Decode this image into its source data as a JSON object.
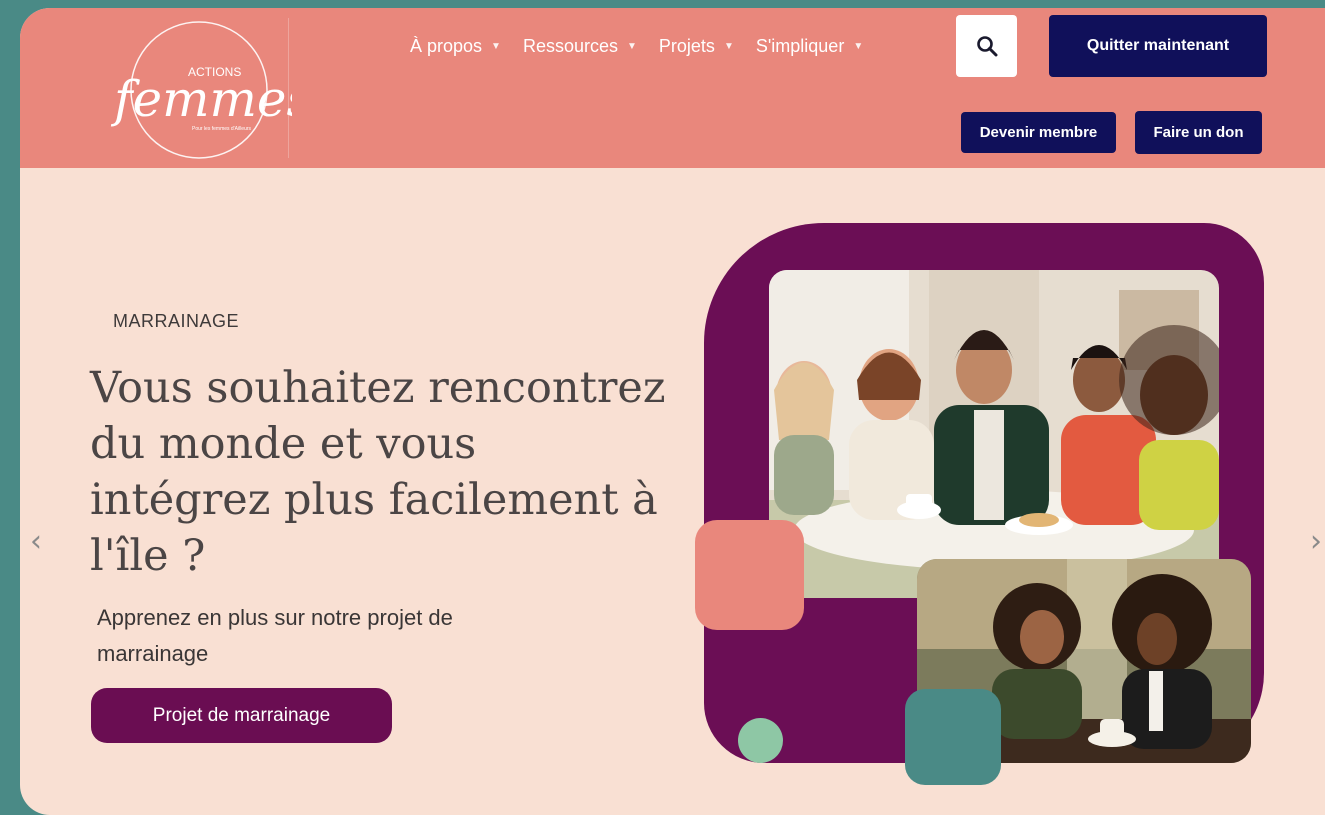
{
  "logo": {
    "small_text": "ACTIONS",
    "script_text": "femmes",
    "tagline": "Pour les femmes d'Ailleurs"
  },
  "nav": {
    "items": [
      {
        "label": "À propos",
        "icon": "caret-down-icon"
      },
      {
        "label": "Ressources",
        "icon": "caret-down-icon"
      },
      {
        "label": "Projets",
        "icon": "caret-down-icon"
      },
      {
        "label": "S'impliquer",
        "icon": "caret-down-icon"
      }
    ]
  },
  "header": {
    "search_icon": "search-icon",
    "quit_label": "Quitter maintenant",
    "member_label": "Devenir membre",
    "donate_label": "Faire un don"
  },
  "hero": {
    "eyebrow": "MARRAINAGE",
    "title": "Vous souhaitez rencontrez du monde et vous intégrez plus facilement à l'île ?",
    "subtitle": "Apprenez en plus sur notre projet de marrainage",
    "cta_label": "Projet de marrainage",
    "prev_arrow": "‹",
    "next_arrow": "›"
  },
  "colors": {
    "header": "#e9877c",
    "hero_bg": "#f9e0d3",
    "navy": "#10105a",
    "plum": "#6a0d52",
    "teal": "#4a8a86",
    "mint": "#8ec7a5"
  }
}
